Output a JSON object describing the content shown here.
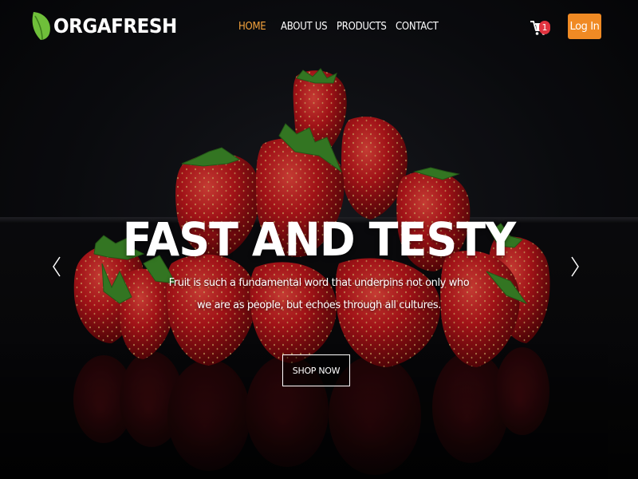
{
  "brand": {
    "name": "ORGAFRESH",
    "leaf_color": "#6fbf3a"
  },
  "nav": {
    "items": [
      {
        "label": "HOME",
        "active": true
      },
      {
        "label": "ABOUT US",
        "active": false
      },
      {
        "label": "PRODUCTS",
        "active": false
      },
      {
        "label": "CONTACT",
        "active": false
      }
    ],
    "active_color": "#f5a33c",
    "cart_icon": "shopping-cart-icon",
    "cart_count": "1",
    "login_label": "Log In",
    "login_color": "#f08a24"
  },
  "hero": {
    "headline": "FAST AND TESTY",
    "subtext": "Fruit is such a fundamental word that underpins not only who we are as people, but echoes through all cultures.",
    "cta_label": "SHOP NOW",
    "prev_icon": "chevron-left-icon",
    "next_icon": "chevron-right-icon",
    "background_image": "strawberries-on-black"
  }
}
